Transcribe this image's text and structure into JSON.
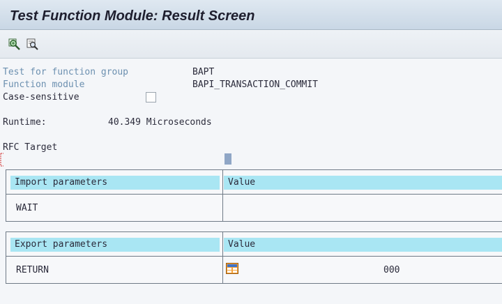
{
  "window": {
    "title": "Test Function Module: Result Screen"
  },
  "toolbar": {
    "buttons": [
      {
        "icon": "magnify-icon"
      },
      {
        "icon": "details-icon"
      }
    ]
  },
  "header_fields": {
    "function_group_label": "Test for function group",
    "function_group_value": "BAPT",
    "function_module_label": "Function module",
    "function_module_value": "BAPI_TRANSACTION_COMMIT",
    "case_sensitive_label": "Case-sensitive",
    "case_sensitive_checked": false,
    "runtime_label": "Runtime:",
    "runtime_value": "40.349 Microseconds",
    "rfc_target_label": "RFC Target"
  },
  "import_table": {
    "col1": "Import parameters",
    "col2": "Value",
    "rows": [
      {
        "name": "WAIT",
        "value": ""
      }
    ]
  },
  "export_table": {
    "col1": "Export parameters",
    "col2": "Value",
    "rows": [
      {
        "name": "RETURN",
        "icon": "structure-icon",
        "value": "000"
      }
    ]
  },
  "colors": {
    "header_cell": "#a9e6f3",
    "muted_label": "#6c90b0",
    "title_bar": "#c9d7e5"
  }
}
